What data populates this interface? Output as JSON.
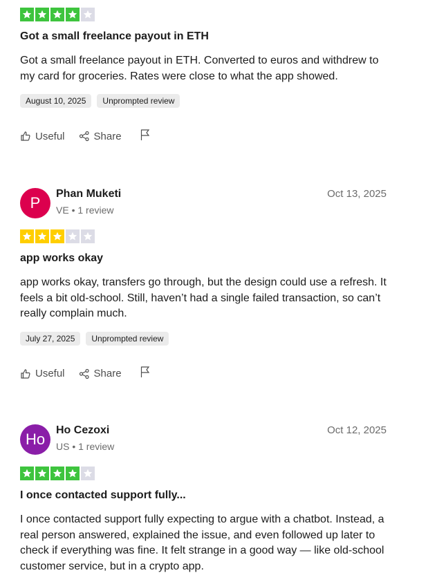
{
  "colors": {
    "star_green": "#00b67a",
    "star_green_bright": "#3ec43e",
    "star_yellow": "#ffce00",
    "star_empty": "#dcdce6",
    "avatar_pink": "#dc004e",
    "avatar_purple": "#8a1ea8"
  },
  "reviews": [
    {
      "rating": 4,
      "rating_color": "#3ec43e",
      "title": "Got a small freelance payout in ETH",
      "body": "Got a small freelance payout in ETH. Converted to euros and withdrew to my card for groceries. Rates were close to what the app showed.",
      "experience_date": "August 10, 2025",
      "tag": "Unprompted review",
      "useful_label": "Useful",
      "share_label": "Share"
    },
    {
      "avatar_initials": "P",
      "avatar_color": "#dc004e",
      "name": "Phan Muketi",
      "meta": "VE • 1 review",
      "date": "Oct 13, 2025",
      "rating": 3,
      "rating_color": "#ffce00",
      "title": "app works okay",
      "body": "app works okay, transfers go through, but the design could use a refresh. It feels a bit old-school. Still, haven’t had a single failed transaction, so can’t really complain much.",
      "experience_date": "July 27, 2025",
      "tag": "Unprompted review",
      "useful_label": "Useful",
      "share_label": "Share"
    },
    {
      "avatar_initials": "Ho",
      "avatar_color": "#8a1ea8",
      "name": "Ho Cezoxi",
      "meta": "US • 1 review",
      "date": "Oct 12, 2025",
      "rating": 4,
      "rating_color": "#3ec43e",
      "title": "I once contacted support fully...",
      "body": "I once contacted support fully expecting to argue with a chatbot. Instead, a real person answered, explained the issue, and even followed up later to check if everything was fine. It felt strange in a good way — like old-school customer service, but in a crypto app."
    }
  ],
  "icons": {
    "star": "star-icon",
    "useful": "thumbs-up-icon",
    "share": "share-icon",
    "report": "flag-icon"
  }
}
